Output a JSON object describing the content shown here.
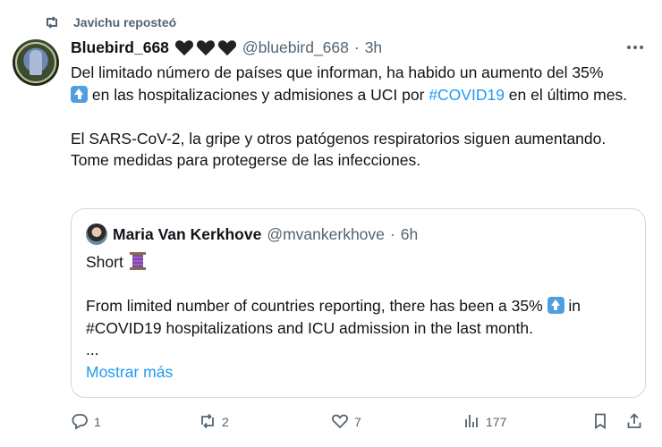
{
  "repost": {
    "label": "Javichu reposteó",
    "icon": "repost-icon"
  },
  "tweet": {
    "author_name": "Bluebird_668",
    "author_emoji": "black-hearts",
    "handle": "@bluebird_668",
    "separator": "·",
    "time": "3h",
    "more_icon": "more-icon",
    "text_1a": "Del limitado número de países que informan, ha habido un aumento del 35%",
    "text_1b": " en las hospitalizaciones y admisiones a UCI por ",
    "hashtag": "#COVID19",
    "text_1c": " en el último mes.",
    "text_2": "El SARS-CoV-2, la gripe y otros patógenos respiratorios siguen aumentando. Tome medidas para protegerse de las infecciones."
  },
  "quote": {
    "author_name": "Maria Van Kerkhove",
    "handle": "@mvankerkhove",
    "separator": "·",
    "time": "6h",
    "line_1": "Short ",
    "text_a": "From limited number of countries reporting, there has been a 35% ",
    "text_b": " in #COVID19 hospitalizations and ICU admission in the last month.",
    "ellipsis": "...",
    "show_more": "Mostrar más"
  },
  "actions": {
    "reply_count": "1",
    "repost_count": "2",
    "like_count": "7",
    "views_count": "177"
  },
  "colors": {
    "accent": "#1d9bf0",
    "secondary_text": "#536471",
    "border": "#cfd9de"
  }
}
